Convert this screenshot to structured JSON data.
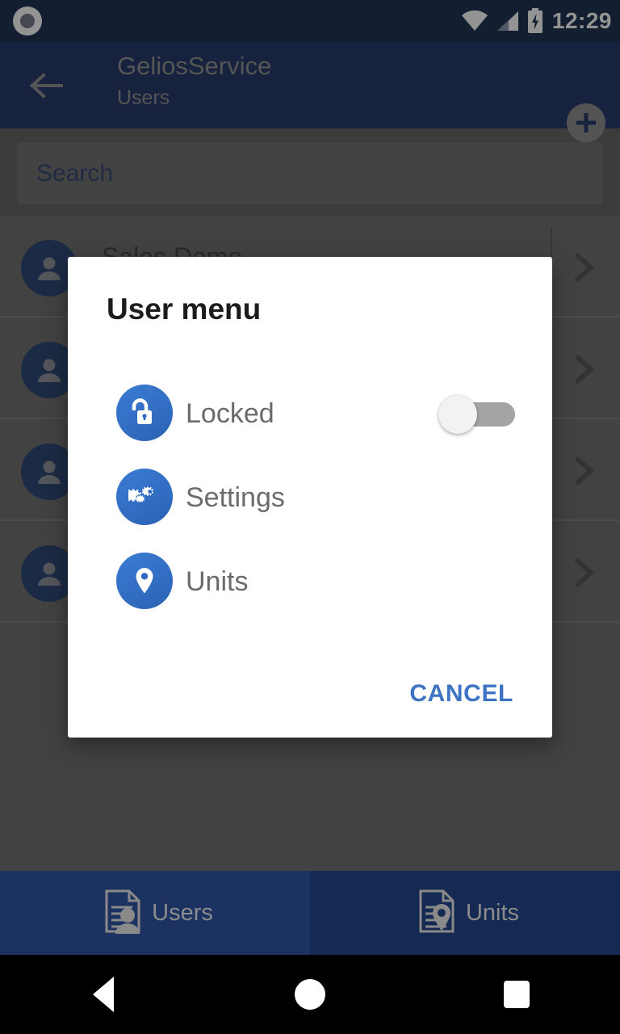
{
  "status_bar": {
    "recording_indicator": "record-indicator-icon",
    "wifi": "wifi-icon",
    "cellular": "cellular-signal-icon",
    "battery": "battery-charging-icon",
    "time": "12:29"
  },
  "app_bar": {
    "back": "back-arrow-icon",
    "title": "GeliosService",
    "subtitle": "Users",
    "add": "add-plus-icon"
  },
  "search": {
    "placeholder": "Search",
    "value": ""
  },
  "list": {
    "rows": [
      {
        "name": "Sales Demo",
        "avatar": "person-avatar-icon",
        "chevron": "chevron-right-icon"
      },
      {
        "name": "",
        "avatar": "person-avatar-icon",
        "chevron": "chevron-right-icon"
      },
      {
        "name": "",
        "avatar": "person-avatar-icon",
        "chevron": "chevron-right-icon"
      },
      {
        "name": "",
        "avatar": "person-avatar-icon",
        "chevron": "chevron-right-icon"
      }
    ]
  },
  "dialog": {
    "title": "User menu",
    "items": [
      {
        "label": "Locked",
        "icon": "unlock-padlock-icon",
        "control": "toggle",
        "toggle_on": false
      },
      {
        "label": "Settings",
        "icon": "gears-icon",
        "control": "none"
      },
      {
        "label": "Units",
        "icon": "map-pin-icon",
        "control": "none"
      }
    ],
    "cancel_label": "CANCEL"
  },
  "bottom_nav": {
    "tabs": [
      {
        "label": "Users",
        "icon": "document-person-icon",
        "selected": true
      },
      {
        "label": "Units",
        "icon": "document-pin-icon",
        "selected": false
      }
    ]
  },
  "system_nav": {
    "back": "system-back-icon",
    "home": "system-home-icon",
    "recents": "system-recents-icon"
  },
  "colors": {
    "app_bar": "#1b3162",
    "status_bar": "#14284b",
    "accent_blue": "#2f6bc2",
    "cancel_blue": "#3f74c4",
    "scrim": "rgba(20,20,20,0.46)",
    "dialog_bg": "#ffffff"
  }
}
